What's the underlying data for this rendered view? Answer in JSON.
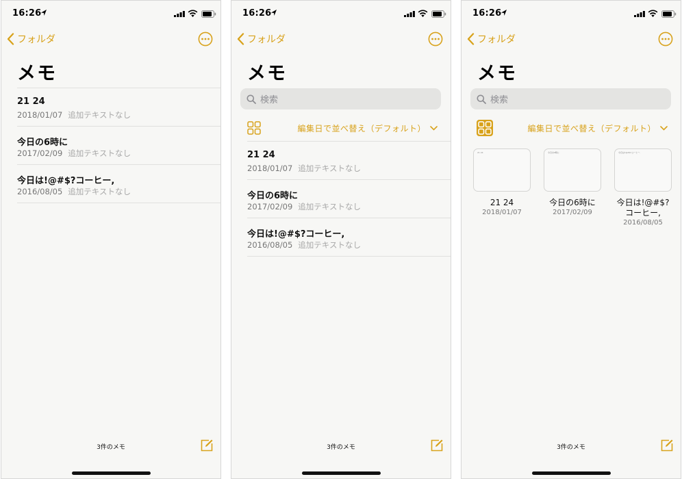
{
  "accent_color": "#d8a21b",
  "status_bar": {
    "time": "16:26"
  },
  "nav": {
    "back_label": "フォルダ",
    "back_icon": "chevron-left-icon",
    "more_icon": "ellipsis-circle-icon"
  },
  "title": "メモ",
  "search": {
    "placeholder": "検索",
    "icon": "search-icon"
  },
  "toolbar": {
    "view_toggle_icon": "grid-view-icon",
    "sort_label": "編集日で並べ替え（デフォルト）",
    "sort_icon": "chevron-down-icon"
  },
  "notes": [
    {
      "title": "21 24",
      "date": "2018/01/07",
      "extra": "追加テキストなし",
      "preview": "21 24"
    },
    {
      "title": "今日の6時に",
      "date": "2017/02/09",
      "extra": "追加テキストなし",
      "preview": "今日の6時に"
    },
    {
      "title": "今日は!@#$?コーヒー,",
      "date": "2016/08/05",
      "extra": "追加テキストなし",
      "preview": "今日は!@#$?コーヒー,"
    }
  ],
  "footer": {
    "count_label": "3件のメモ",
    "compose_icon": "compose-icon"
  },
  "screens": [
    "list-view",
    "list-view-with-search",
    "gallery-view"
  ]
}
